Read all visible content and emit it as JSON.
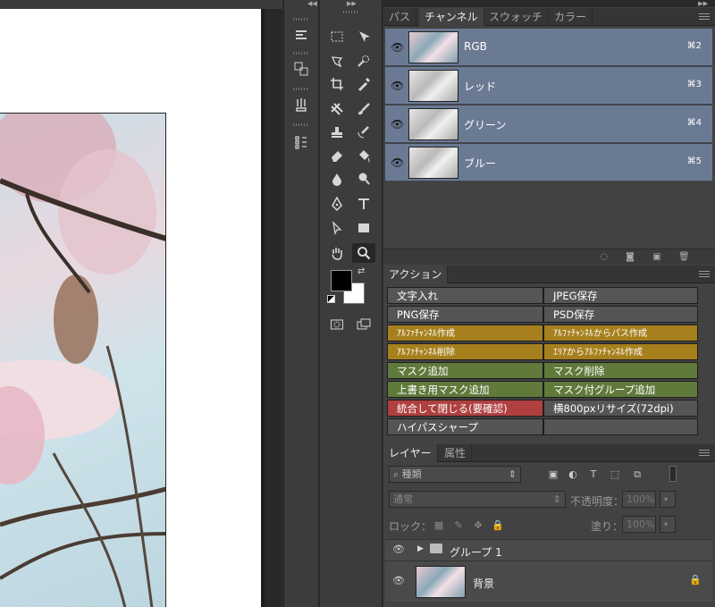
{
  "channels_panel": {
    "tabs": [
      "パス",
      "チャンネル",
      "スウォッチ",
      "カラー"
    ],
    "active_tab": "チャンネル",
    "channels": [
      {
        "name": "RGB",
        "shortcut": "⌘2"
      },
      {
        "name": "レッド",
        "shortcut": "⌘3"
      },
      {
        "name": "グリーン",
        "shortcut": "⌘4"
      },
      {
        "name": "ブルー",
        "shortcut": "⌘5"
      }
    ]
  },
  "actions_panel": {
    "tab": "アクション",
    "buttons": [
      {
        "label": "文字入れ",
        "color": "gray"
      },
      {
        "label": "JPEG保存",
        "color": "gray"
      },
      {
        "label": "PNG保存",
        "color": "gray"
      },
      {
        "label": "PSD保存",
        "color": "gray"
      },
      {
        "label": "ｱﾙﾌｧﾁｬﾝﾈﾙ作成",
        "color": "orange"
      },
      {
        "label": "ｱﾙﾌｧﾁｬﾝﾈﾙからパス作成",
        "color": "orange"
      },
      {
        "label": "ｱﾙﾌｧﾁｬﾝﾈﾙ削除",
        "color": "orange"
      },
      {
        "label": "ｴﾘｱからｱﾙﾌｧﾁｬﾝﾈﾙ作成",
        "color": "orange"
      },
      {
        "label": "マスク追加",
        "color": "green"
      },
      {
        "label": "マスク削除",
        "color": "green"
      },
      {
        "label": "上書き用マスク追加",
        "color": "green"
      },
      {
        "label": "マスク付グループ追加",
        "color": "green"
      },
      {
        "label": "統合して閉じる(要確認)",
        "color": "red"
      },
      {
        "label": "横800pxリサイズ(72dpi)",
        "color": "gray"
      },
      {
        "label": "ハイパスシャープ",
        "color": "gray"
      },
      {
        "label": "",
        "color": "gray"
      }
    ],
    "colors": {
      "gray": "#555555",
      "orange": "#a7801e",
      "green": "#5f7a3b",
      "red": "#b04040"
    }
  },
  "layers_panel": {
    "tabs": [
      "レイヤー",
      "属性"
    ],
    "active_tab": "レイヤー",
    "filter_label": "種類",
    "blend_mode": "通常",
    "opacity_label": "不透明度：",
    "opacity_value": "100%",
    "lock_label": "ロック：",
    "fill_label": "塗り：",
    "fill_value": "100%",
    "layers": [
      {
        "name": "グループ 1",
        "type": "group"
      },
      {
        "name": "背景",
        "type": "background",
        "locked": true
      }
    ]
  }
}
